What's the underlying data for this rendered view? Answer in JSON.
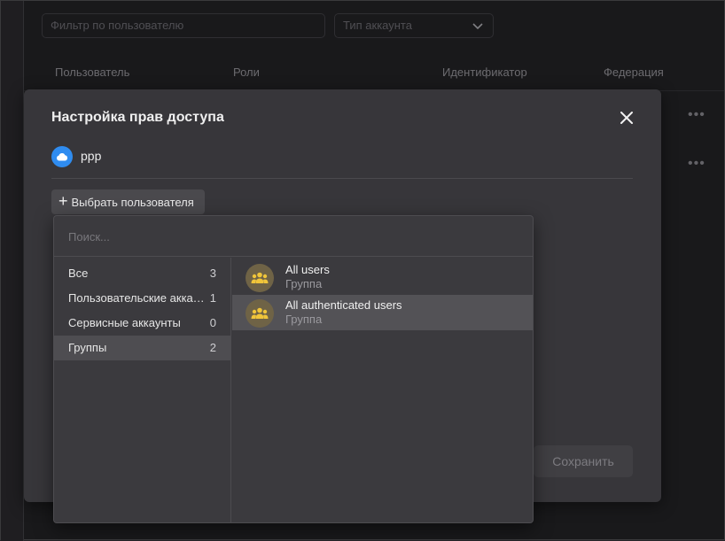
{
  "filters": {
    "user_filter_placeholder": "Фильтр по пользователю",
    "account_type_placeholder": "Тип аккаунта"
  },
  "table": {
    "columns": [
      "Пользователь",
      "Роли",
      "Идентификатор",
      "Федерация"
    ],
    "row_action_icon": "ellipsis-icon"
  },
  "modal": {
    "title": "Настройка прав доступа",
    "subject": {
      "name": "ppp",
      "avatar_icon": "cloud-icon",
      "avatar_color": "#2f8cf0"
    },
    "choose_user_label": "Выбрать пользователя",
    "save_label": "Сохранить"
  },
  "picker": {
    "search_placeholder": "Поиск...",
    "categories": [
      {
        "label": "Все",
        "count": "3"
      },
      {
        "label": "Пользовательские аккаунты",
        "count": "1"
      },
      {
        "label": "Сервисные аккаунты",
        "count": "0"
      },
      {
        "label": "Группы",
        "count": "2"
      }
    ],
    "selected_category": "Группы",
    "results": [
      {
        "name": "All users",
        "type": "Группа",
        "icon": "group-icon"
      },
      {
        "name": "All authenticated users",
        "type": "Группа",
        "icon": "group-icon"
      }
    ],
    "group_icon_color": "#f0c53a"
  }
}
